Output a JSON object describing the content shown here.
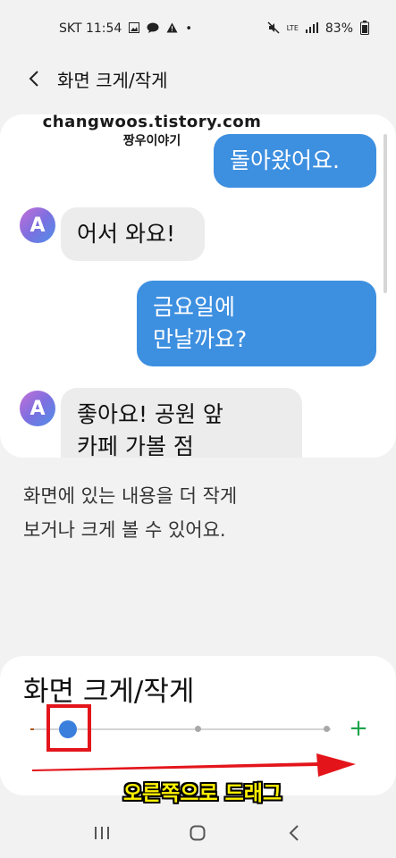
{
  "status_bar": {
    "carrier_time": "SKT 11:54",
    "battery": "83%",
    "network": "LTE"
  },
  "header": {
    "title": "화면 크게/작게"
  },
  "watermark": {
    "url": "changwoos.tistory.com",
    "name": "짱우이야기"
  },
  "preview": {
    "messages": [
      {
        "type": "sent",
        "text": "돌아왔어요."
      },
      {
        "type": "received",
        "text": "어서 와요!"
      },
      {
        "type": "sent",
        "line1": "금요일에",
        "line2": "만날까요?"
      },
      {
        "type": "received",
        "line1": "좋아요! 공원 앞",
        "line2": "카페 가볼 점"
      }
    ],
    "avatar_letter": "A"
  },
  "description": {
    "line1": "화면에 있는 내용을 더 작게",
    "line2": "보거나 크게 볼 수 있어요."
  },
  "zoom_card": {
    "title": "화면 크게/작게",
    "slider_level": 0,
    "slider_steps": 4,
    "plus_label": "+",
    "caption": "오른쪽으로 드래그"
  },
  "colors": {
    "sent_bubble": "#3d8fe0",
    "received_bubble": "#ececec",
    "slider_thumb": "#3b7fdd",
    "plus": "#1aa34a",
    "annotation_red": "#e3151b",
    "caption_yellow": "#fff200"
  }
}
